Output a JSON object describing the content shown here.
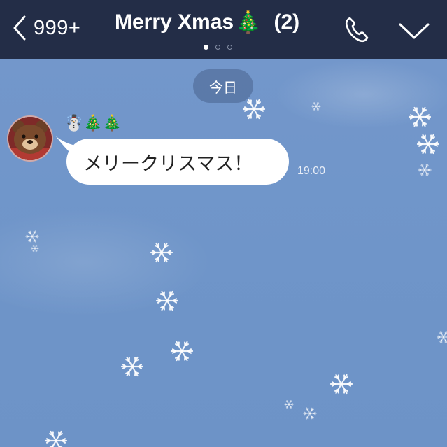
{
  "header": {
    "back_count": "999+",
    "title": "Merry Xmas",
    "title_emoji": "🎄",
    "member_count": "(2)",
    "page_dots": [
      true,
      false,
      false
    ],
    "icons": {
      "back": "chevron-left-icon",
      "call": "phone-icon",
      "menu": "chevron-down-icon"
    }
  },
  "chat": {
    "date_separator": "今日",
    "messages": [
      {
        "sender_emoji": "☃️🎄🎄",
        "text": "メリークリスマス！",
        "time": "19:00",
        "avatar": "bear-avatar"
      }
    ]
  },
  "colors": {
    "header_bg": "#232d47",
    "chat_bg": "#7096c9",
    "bubble_bg": "#ffffff",
    "date_pill_bg": "#48628e"
  }
}
